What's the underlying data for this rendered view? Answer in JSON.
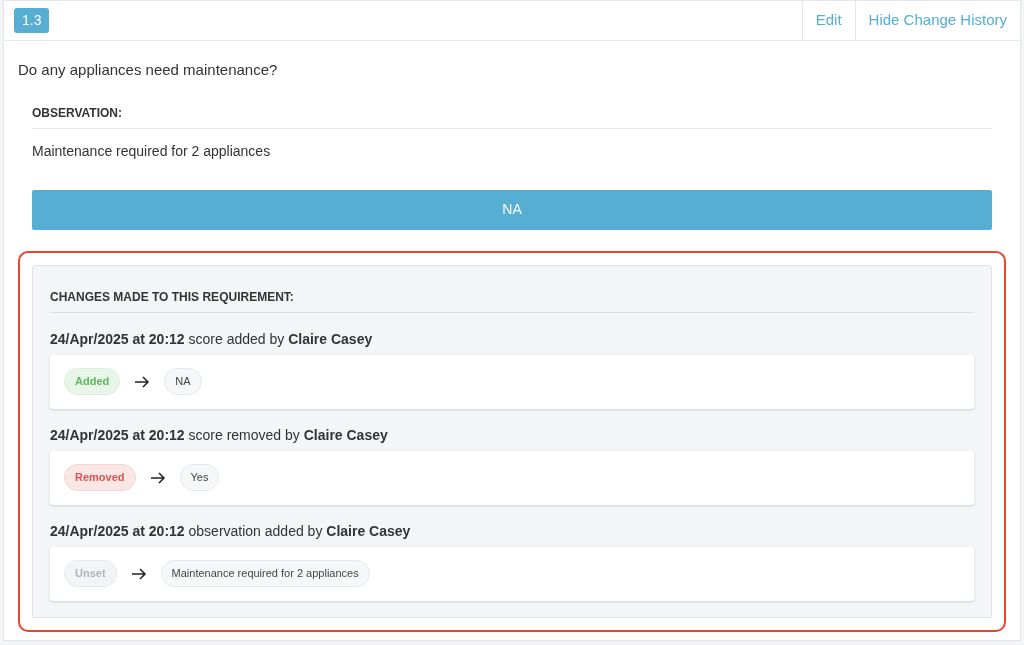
{
  "header": {
    "number": "1.3",
    "actions": [
      "Edit",
      "Hide Change History"
    ]
  },
  "question": "Do any appliances need maintenance?",
  "observation": {
    "label": "OBSERVATION:",
    "text": "Maintenance required for 2 appliances"
  },
  "score": "NA",
  "history": {
    "title": "CHANGES MADE TO THIS REQUIREMENT:",
    "changes": [
      {
        "summary": "**24/Apr/2025 at 20:12** score added by **Claire Casey**",
        "from": {
          "kind": "added",
          "label": "Added"
        },
        "to": "NA"
      },
      {
        "summary": "**24/Apr/2025 at 20:12** score removed by **Claire Casey**",
        "from": {
          "kind": "removed",
          "label": "Removed"
        },
        "to": "Yes"
      },
      {
        "summary": "**24/Apr/2025 at 20:12** observation added by **Claire Casey**",
        "from": {
          "kind": "unset",
          "label": "Unset"
        },
        "to": "Maintenance required for 2 appliances"
      }
    ]
  }
}
